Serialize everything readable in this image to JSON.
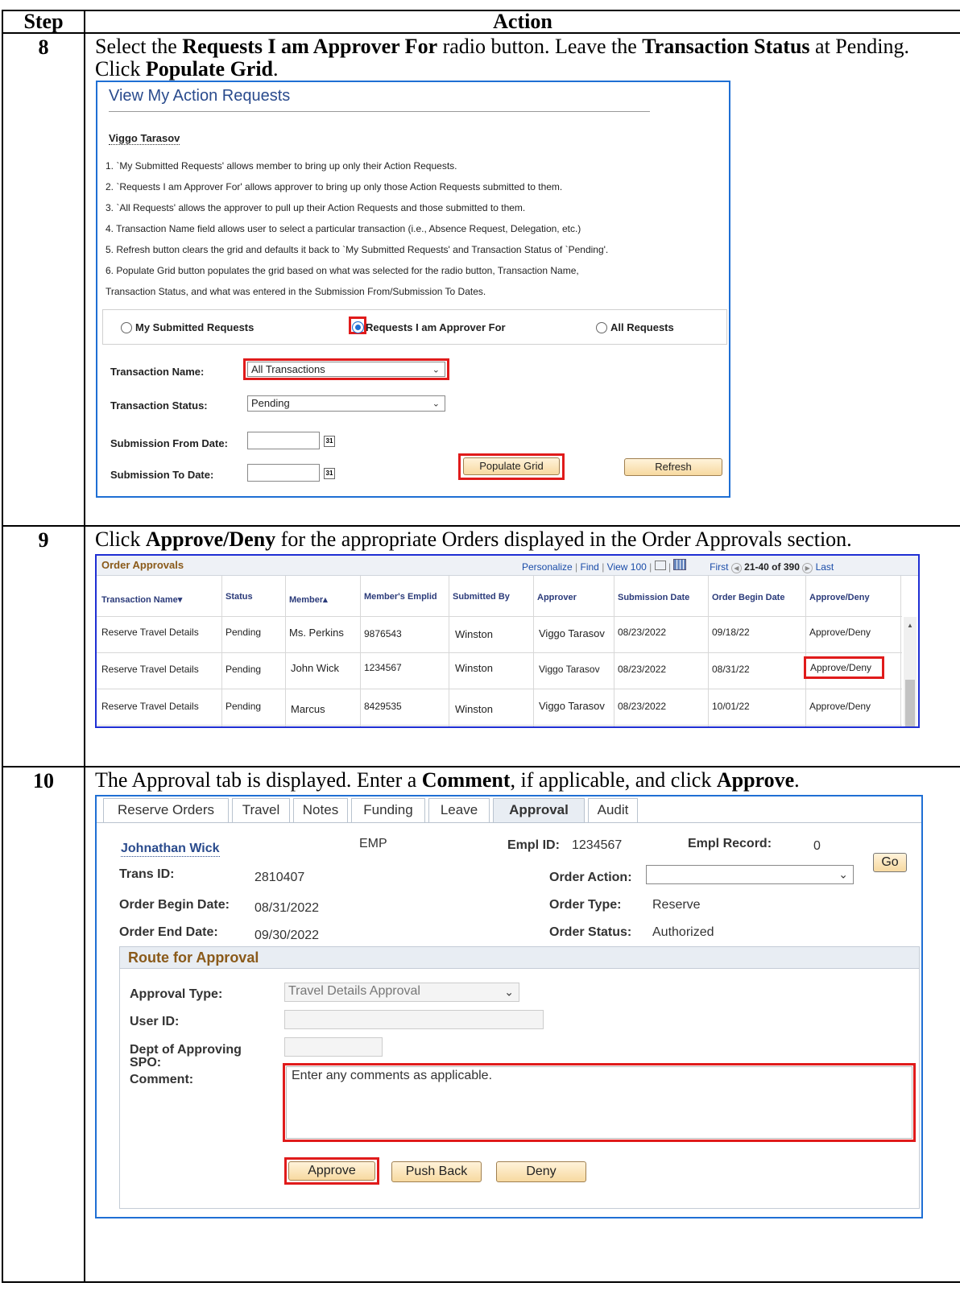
{
  "headers": {
    "step": "Step",
    "action": "Action"
  },
  "step8": {
    "num": "8",
    "text": {
      "a": "Select the ",
      "b": "Requests I am Approver For",
      "c": " radio button. Leave the ",
      "d": "Transaction Status",
      "e": " at Pending. Click ",
      "f": "Populate Grid",
      "g": "."
    },
    "ui": {
      "title": "View My Action Requests",
      "user": "Viggo Tarasov",
      "notes": [
        "1. `My Submitted Requests' allows member to bring up only their Action Requests.",
        "2. `Requests I am Approver For' allows approver to bring up only those Action Requests submitted to them.",
        "3. `All Requests' allows the approver to pull up their Action Requests and those submitted to them.",
        "4. Transaction Name field allows user to select a particular transaction (i.e., Absence Request, Delegation, etc.)",
        "5. Refresh button clears the grid and defaults it back to `My Submitted Requests' and Transaction Status of `Pending'.",
        "6. Populate Grid button populates the grid based on what was selected for the radio button, Transaction Name,",
        "Transaction Status, and what was entered in the Submission From/Submission To Dates."
      ],
      "radio_mine": "My Submitted Requests",
      "radio_approver": "Requests I am Approver For",
      "radio_all": "All Requests",
      "trans_name_label": "Transaction Name:",
      "trans_name_value": "All Transactions",
      "trans_status_label": "Transaction Status:",
      "trans_status_value": "Pending",
      "from_label": "Submission From Date:",
      "to_label": "Submission To Date:",
      "cal_icon": "31",
      "populate": "Populate Grid",
      "refresh": "Refresh"
    }
  },
  "step9": {
    "num": "9",
    "text": {
      "a": "Click ",
      "b": "Approve/Deny",
      "c": " for the appropriate Orders displayed in the Order Approvals section."
    },
    "ui": {
      "title": "Order Approvals",
      "toolbar": {
        "personalize": "Personalize",
        "find": "Find",
        "view": "View 100",
        "first": "First",
        "range": "21-40 of 390",
        "last": "Last",
        "sep": "|"
      },
      "columns": [
        "Transaction Name▾",
        "Status",
        "Member▴",
        "Member's Emplid",
        "Submitted By",
        "Approver",
        "Submission Date",
        "Order Begin Date",
        "Approve/Deny"
      ],
      "rows": [
        [
          "Reserve Travel Details",
          "Pending",
          "Ms. Perkins",
          "9876543",
          "Winston",
          "Viggo Tarasov",
          "08/23/2022",
          "09/18/22",
          "Approve/Deny"
        ],
        [
          "Reserve Travel Details",
          "Pending",
          "John Wick",
          "1234567",
          "Winston",
          "Viggo Tarasov",
          "08/23/2022",
          "08/31/22",
          "Approve/Deny"
        ],
        [
          "Reserve Travel Details",
          "Pending",
          "Marcus",
          "8429535",
          "Winston",
          "Viggo Tarasov",
          "08/23/2022",
          "10/01/22",
          "Approve/Deny"
        ]
      ]
    }
  },
  "step10": {
    "num": "10",
    "text": {
      "a": "The Approval tab is displayed. Enter a ",
      "b": "Comment",
      "c": ", if applicable, and click ",
      "d": "Approve",
      "e": "."
    },
    "ui": {
      "tabs": [
        "Reserve Orders",
        "Travel",
        "Notes",
        "Funding",
        "Leave",
        "Approval",
        "Audit"
      ],
      "name": "Johnathan Wick",
      "emp": "EMP",
      "empl_id_label": "Empl ID:",
      "empl_id": "1234567",
      "empl_rec_label": "Empl Record:",
      "empl_rec": "0",
      "go": "Go",
      "trans_id_label": "Trans ID:",
      "trans_id": "2810407",
      "order_action_label": "Order Action:",
      "begin_label": "Order Begin Date:",
      "begin": "08/31/2022",
      "type_label": "Order Type:",
      "type": "Reserve",
      "end_label": "Order End Date:",
      "end": "09/30/2022",
      "status_label": "Order Status:",
      "status": "Authorized",
      "route_title": "Route for Approval",
      "approval_type_label": "Approval Type:",
      "approval_type": "Travel Details Approval",
      "user_id_label": "User ID:",
      "dept_label_1": "Dept of Approving",
      "dept_label_2": "SPO:",
      "comment_label": "Comment:",
      "comment_placeholder": "Enter any comments as applicable.",
      "approve": "Approve",
      "push_back": "Push Back",
      "deny": "Deny"
    }
  }
}
